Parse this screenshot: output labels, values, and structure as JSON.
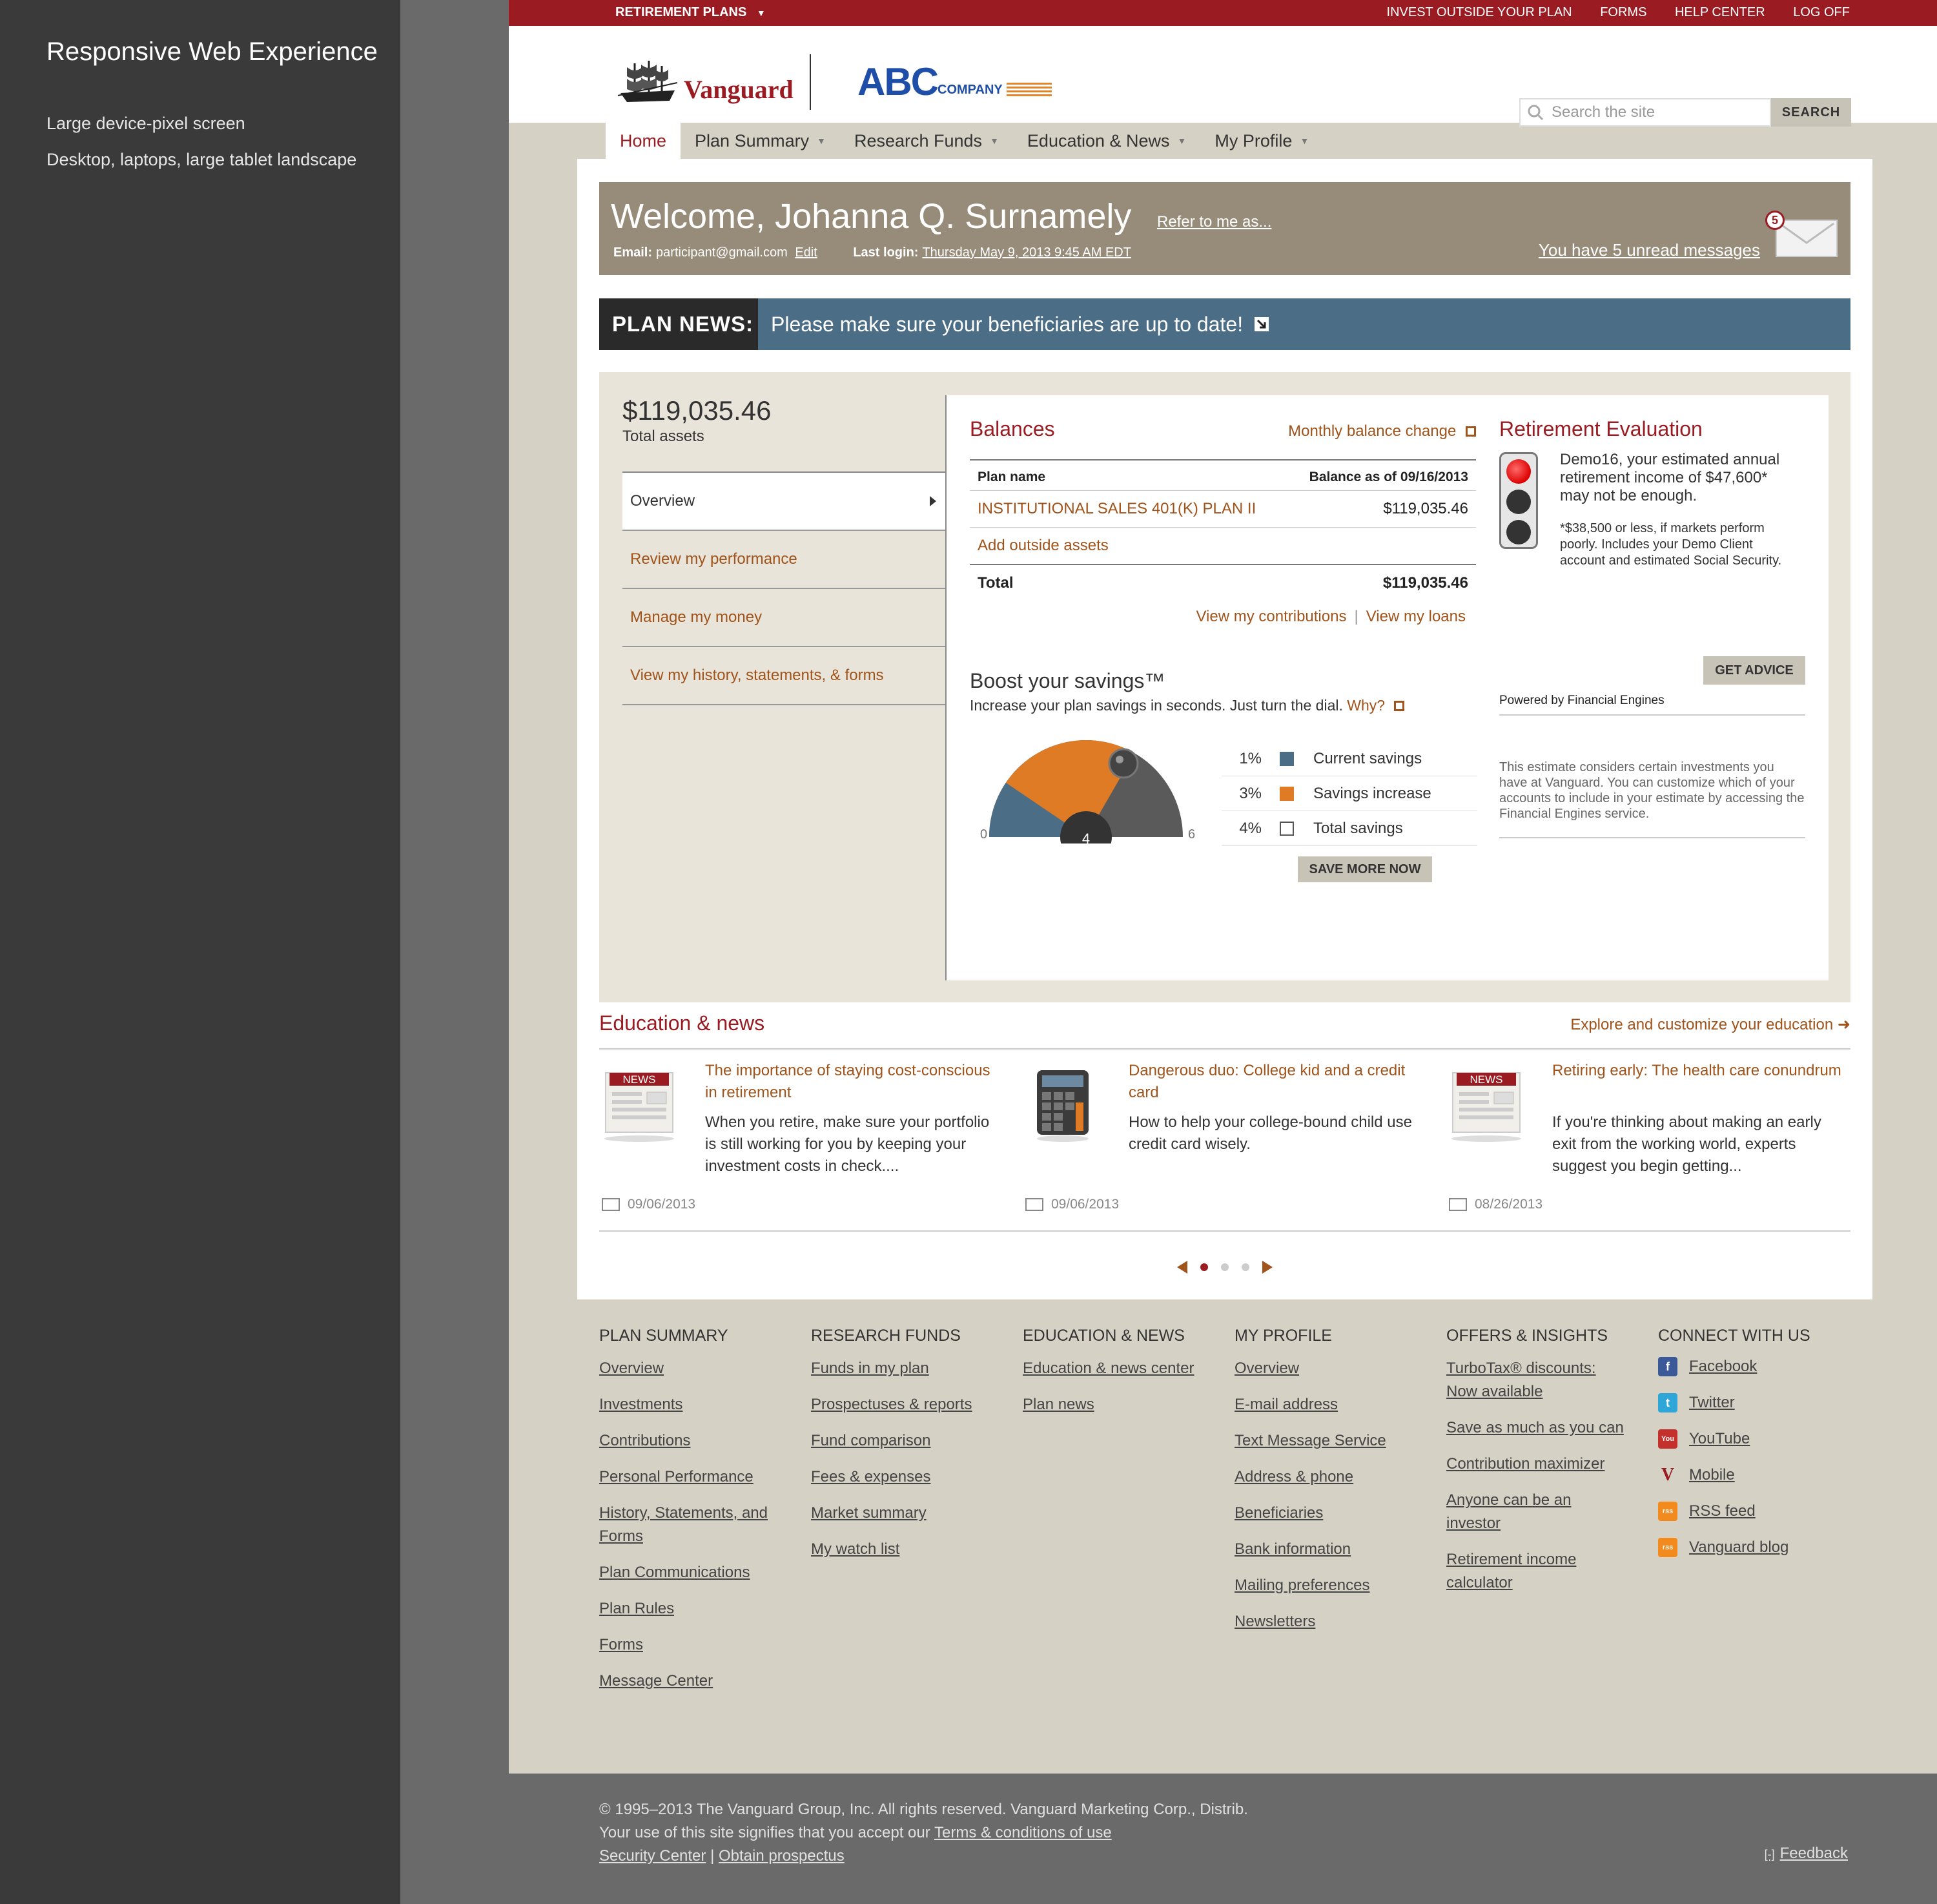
{
  "side_panel": {
    "title": "Responsive Web Experience",
    "lines": [
      "Large device-pixel screen",
      "Desktop, laptops, large tablet landscape"
    ]
  },
  "topbar": {
    "left": "RETIREMENT PLANS",
    "links": [
      "INVEST OUTSIDE YOUR PLAN",
      "FORMS",
      "HELP CENTER",
      "LOG OFF"
    ]
  },
  "header": {
    "logo_vanguard": "Vanguard",
    "logo_abc": "ABC",
    "logo_company": "COMPANY",
    "search_placeholder": "Search the site",
    "search_button": "SEARCH"
  },
  "nav": [
    "Home",
    "Plan Summary",
    "Research Funds",
    "Education & News",
    "My Profile"
  ],
  "welcome": {
    "title": "Welcome, Johanna Q. Surnamely",
    "refer": "Refer to me as...",
    "email_label": "Email:",
    "email": "participant@gmail.com",
    "edit": "Edit",
    "login_label": "Last login:",
    "login": "Thursday May 9, 2013 9:45 AM EDT",
    "unread": "You have 5 unread messages",
    "badge": "5"
  },
  "plan_news": {
    "label": "PLAN NEWS:",
    "text": "Please make sure your beneficiaries are up to date!"
  },
  "dashboard": {
    "total": "$119,035.46",
    "total_label": "Total assets",
    "menu": [
      "Overview",
      "Review my performance",
      "Manage my money",
      "View my history, statements, & forms"
    ]
  },
  "balances": {
    "title": "Balances",
    "link": "Monthly balance change",
    "col_plan": "Plan name",
    "col_balance": "Balance as of 09/16/2013",
    "plan_name": "INSTITUTIONAL SALES 401(K) PLAN II",
    "plan_balance": "$119,035.46",
    "add_outside": "Add outside assets",
    "total_label": "Total",
    "total_value": "$119,035.46",
    "link_contrib": "View my contributions",
    "link_loans": "View my loans"
  },
  "boost": {
    "title": "Boost your savings™",
    "subtitle": "Increase your plan savings in seconds. Just turn the dial.",
    "why": "Why?",
    "dial_min": "0",
    "dial_max": "6",
    "dial_value": "4",
    "legend": [
      {
        "pct": "1%",
        "label": "Current savings",
        "color": "#4b6d86"
      },
      {
        "pct": "3%",
        "label": "Savings increase",
        "color": "#e07b25"
      },
      {
        "pct": "4%",
        "label": "Total savings",
        "color": "#ffffff"
      }
    ],
    "button": "SAVE MORE NOW"
  },
  "retirement": {
    "title": "Retirement Evaluation",
    "text": "Demo16, your estimated annual retirement income of $47,600* may not be enough.",
    "note": "*$38,500 or less, if markets perform poorly. Includes your Demo Client account and estimated Social Security.",
    "button": "GET ADVICE",
    "powered": "Powered by Financial Engines",
    "estimate": "This estimate considers certain investments you have at Vanguard. You can customize which of your accounts to include in your estimate by accessing the Financial Engines service."
  },
  "education": {
    "title": "Education & news",
    "explore": "Explore and customize your education",
    "items": [
      {
        "badge": "NEWS",
        "title": "The importance of staying cost-conscious in retirement",
        "desc": "When you retire, make sure your portfolio is still working for you by keeping your investment costs in check....",
        "date": "09/06/2013"
      },
      {
        "badge": "",
        "title": "Dangerous duo: College kid and a credit card",
        "desc": "How to help your college-bound child use credit card wisely.",
        "date": "09/06/2013"
      },
      {
        "badge": "NEWS",
        "title": "Retiring early: The health care conundrum",
        "desc": "If you're thinking about making an early exit from the working world, experts suggest you begin getting...",
        "date": "08/26/2013"
      }
    ]
  },
  "footer": {
    "columns": [
      {
        "title": "PLAN SUMMARY",
        "links": [
          "Overview",
          "Investments",
          "Contributions",
          "Personal Performance",
          "History, Statements, and Forms",
          "Plan Communications",
          "Plan Rules",
          "Forms",
          "Message Center"
        ]
      },
      {
        "title": "RESEARCH FUNDS",
        "links": [
          "Funds in my plan",
          "Prospectuses & reports",
          "Fund comparison",
          "Fees & expenses",
          "Market summary",
          "My watch list"
        ]
      },
      {
        "title": "EDUCATION & NEWS",
        "links": [
          "Education & news center",
          "Plan news"
        ]
      },
      {
        "title": "MY PROFILE",
        "links": [
          "Overview",
          "E-mail address",
          "Text Message Service",
          "Address & phone",
          "Beneficiaries",
          "Bank information",
          "Mailing preferences",
          "Newsletters"
        ]
      },
      {
        "title": "OFFERS & INSIGHTS",
        "links": [
          "TurboTax® discounts: Now available",
          "Save as much as you can",
          "Contribution maximizer",
          "Anyone can be an investor",
          "Retirement income calculator"
        ]
      }
    ],
    "connect_title": "CONNECT WITH US",
    "social": [
      {
        "label": "Facebook",
        "icon": "f",
        "color": "#3b5998"
      },
      {
        "label": "Twitter",
        "icon": "t",
        "color": "#2fa6d8"
      },
      {
        "label": "YouTube",
        "icon": "You",
        "color": "#c4302b"
      },
      {
        "label": "Mobile",
        "icon": "V",
        "color": "#9a1c22"
      },
      {
        "label": "RSS feed",
        "icon": "rss",
        "color": "#f28a1e"
      },
      {
        "label": "Vanguard blog",
        "icon": "rss",
        "color": "#f28a1e"
      }
    ]
  },
  "legal": {
    "line1": "© 1995–2013  The Vanguard Group, Inc. All rights reserved. Vanguard Marketing Corp., Distrib.",
    "line2_pre": "Your use of this site signifies that you accept our",
    "terms": "Terms & conditions of use",
    "security": "Security Center",
    "prospectus": "Obtain prospectus",
    "feedback": "Feedback"
  }
}
